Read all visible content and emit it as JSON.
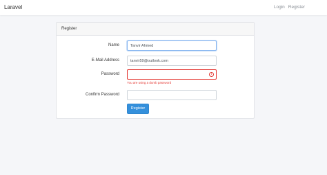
{
  "navbar": {
    "brand": "Laravel",
    "links": [
      "Login",
      "Register"
    ]
  },
  "card": {
    "title": "Register"
  },
  "form": {
    "name_label": "Name",
    "name_value": "Tanvir Ahmed",
    "email_label": "E-Mail Address",
    "email_value": "tanvir59@outlook.com",
    "password_label": "Password",
    "password_value": "",
    "password_error": "You are using a dumb password",
    "confirm_label": "Confirm Password",
    "confirm_value": "",
    "submit_label": "Register"
  },
  "colors": {
    "accent": "#3490dc",
    "error": "#e3342f",
    "background": "#f5f6f9"
  }
}
